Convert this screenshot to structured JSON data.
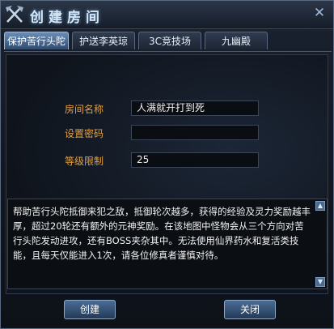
{
  "window": {
    "title": "创建房间"
  },
  "tabs": [
    {
      "label": "保护苦行头陀",
      "active": true
    },
    {
      "label": "护送李英琼",
      "active": false
    },
    {
      "label": "3C竞技场",
      "active": false
    },
    {
      "label": "九幽殿",
      "active": false
    }
  ],
  "form": {
    "room_name_label": "房间名称",
    "room_name_value": "人满就开打到死",
    "password_label": "设置密码",
    "password_value": "",
    "level_label": "等级限制",
    "level_value": "25"
  },
  "description": "帮助苦行头陀抵御来犯之敌，抵御轮次越多，获得的经验及灵力奖励越丰厚，超过20轮还有额外的元神奖励。在该地图中怪物会从三个方向对苦行头陀发动进攻，还有BOSS夹杂其中。无法使用仙界药水和复活类技能，且每天仅能进入1次，请各位修真者谨慎对待。",
  "buttons": {
    "create": "创建",
    "close": "关闭"
  },
  "colors": {
    "label": "#e6a040",
    "accent": "#6b8eb6"
  },
  "icons": {
    "emblem": "crossed-axes-icon",
    "close": "close-icon"
  }
}
